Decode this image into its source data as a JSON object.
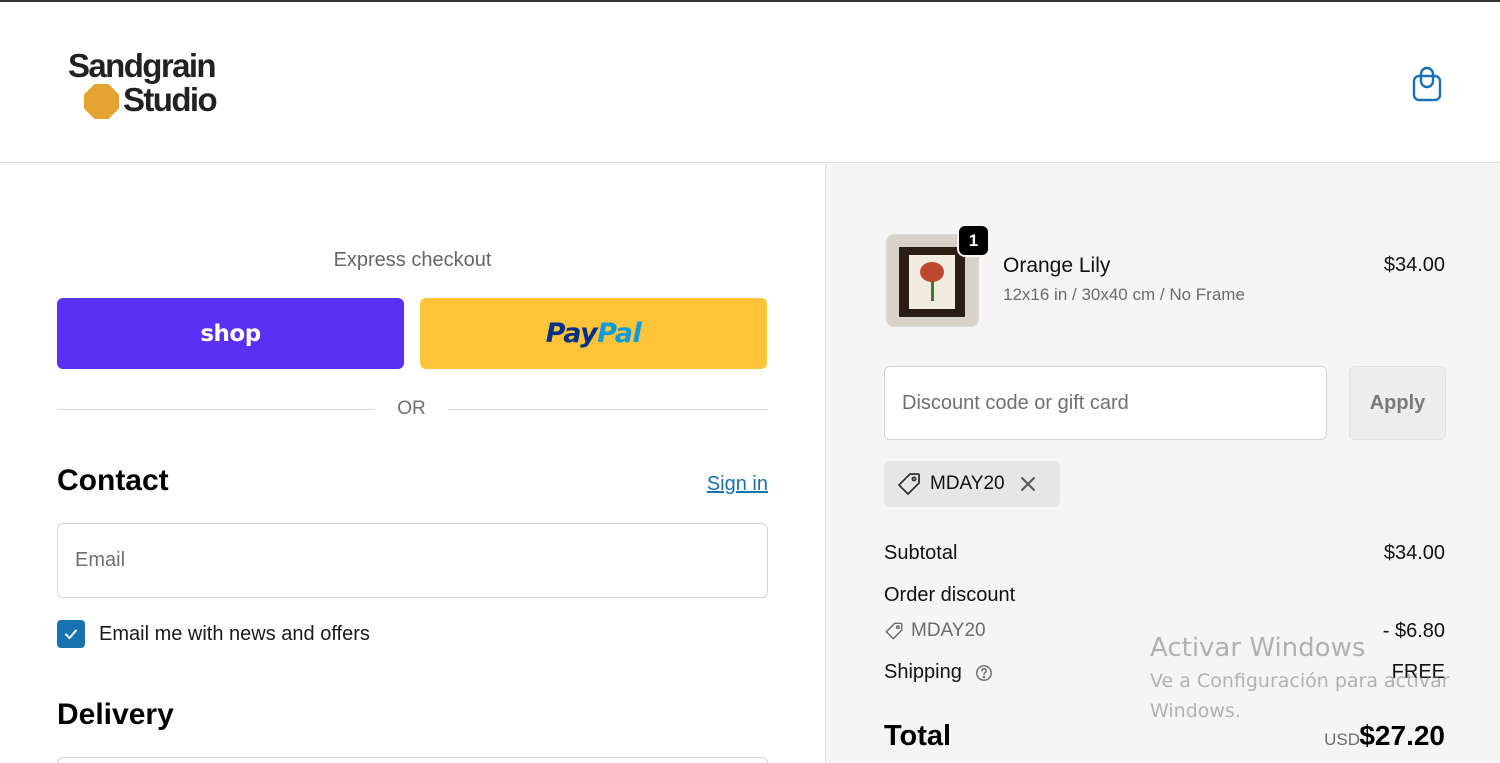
{
  "brand": {
    "line1": "Sandgrain",
    "line2": "Studio",
    "logo_color": "#e5a331"
  },
  "header": {
    "cart_icon": "shopping-bag-icon"
  },
  "express_checkout": {
    "title": "Express checkout",
    "shop_label": "shop",
    "shop_color": "#5a31f4",
    "paypal_part1": "Pay",
    "paypal_part2": "Pal",
    "paypal_color": "#ffc439",
    "divider_text": "OR"
  },
  "contact": {
    "title": "Contact",
    "sign_in": "Sign in",
    "email_placeholder": "Email",
    "email_value": "",
    "newsletter_label": "Email me with news and offers",
    "newsletter_checked": true
  },
  "delivery": {
    "title": "Delivery"
  },
  "order": {
    "item": {
      "name": "Orange Lily",
      "variant": "12x16 in / 30x40 cm / No Frame",
      "price": "$34.00",
      "quantity": "1"
    },
    "discount": {
      "placeholder": "Discount code or gift card",
      "apply_label": "Apply",
      "applied_code": "MDAY20"
    },
    "summary": {
      "subtotal_label": "Subtotal",
      "subtotal_value": "$34.00",
      "discount_label": "Order discount",
      "discount_code": "MDAY20",
      "discount_value": "- $6.80",
      "shipping_label": "Shipping",
      "shipping_value": "FREE",
      "total_label": "Total",
      "total_currency": "USD",
      "total_value": "$27.20"
    }
  },
  "watermark": {
    "title": "Activar Windows",
    "subtitle": "Ve a Configuración para activar Windows."
  },
  "colors": {
    "accent_link": "#1773b0",
    "panel_bg": "#f5f5f5"
  }
}
